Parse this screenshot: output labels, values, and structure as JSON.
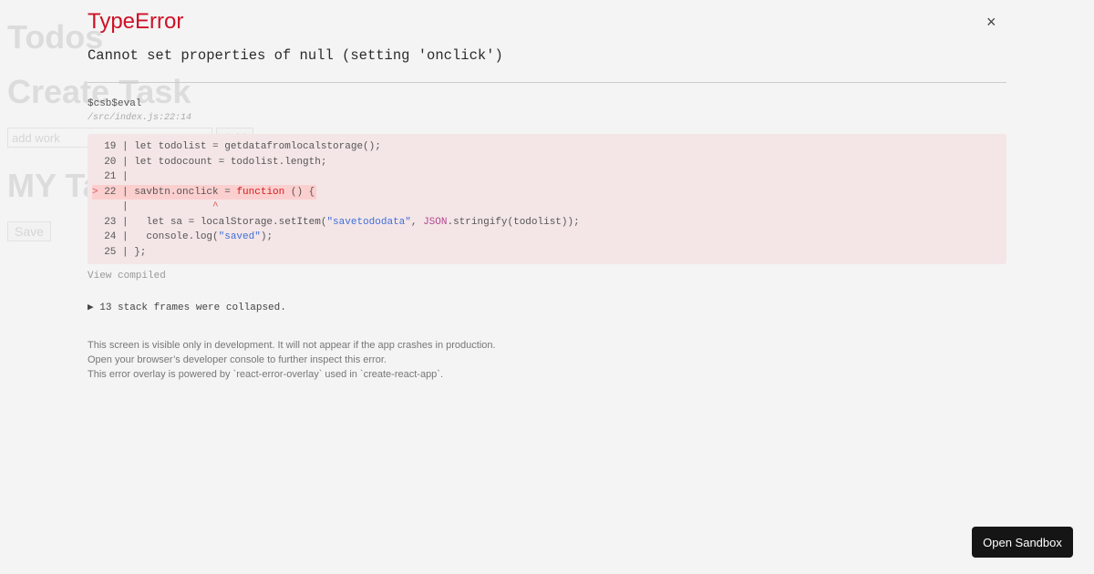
{
  "app": {
    "heading": "Todos",
    "create_heading": "Create Task",
    "input_placeholder": "add work",
    "add_label": "Add",
    "my_tasks_heading": "MY Task",
    "save_label": "Save"
  },
  "overlay": {
    "error_type": "TypeError",
    "message": "Cannot set properties of null (setting 'onclick')",
    "function_name": "$csb$eval",
    "location": "/src/index.js:22:14",
    "code_lines": [
      {
        "marker": "  ",
        "num": "19",
        "text": "let todolist = getdatafromlocalstorage();"
      },
      {
        "marker": "  ",
        "num": "20",
        "text": "let todocount = todolist.length;"
      },
      {
        "marker": "  ",
        "num": "21",
        "text": ""
      },
      {
        "marker": "> ",
        "num": "22",
        "text": "savbtn.onclick = function () {"
      },
      {
        "marker": "  ",
        "num": "  ",
        "text": "             ^"
      },
      {
        "marker": "  ",
        "num": "23",
        "text": "  let sa = localStorage.setItem(\"savetododata\", JSON.stringify(todolist));"
      },
      {
        "marker": "  ",
        "num": "24",
        "text": "  console.log(\"saved\");"
      },
      {
        "marker": "  ",
        "num": "25",
        "text": "};"
      }
    ],
    "view_compiled": "View compiled",
    "collapsed_frames": "▶ 13 stack frames were collapsed.",
    "footer": [
      "This screen is visible only in development. It will not appear if the app crashes in production.",
      "Open your browser’s developer console to further inspect this error.",
      "This error overlay is powered by `react-error-overlay` used in `create-react-app`."
    ],
    "close_icon": "×"
  },
  "open_sandbox": "Open Sandbox",
  "colors": {
    "error": "#ce1126",
    "code_bg": "#f4e6e7",
    "highlight": "#fccfcf",
    "button_bg": "#151515"
  }
}
